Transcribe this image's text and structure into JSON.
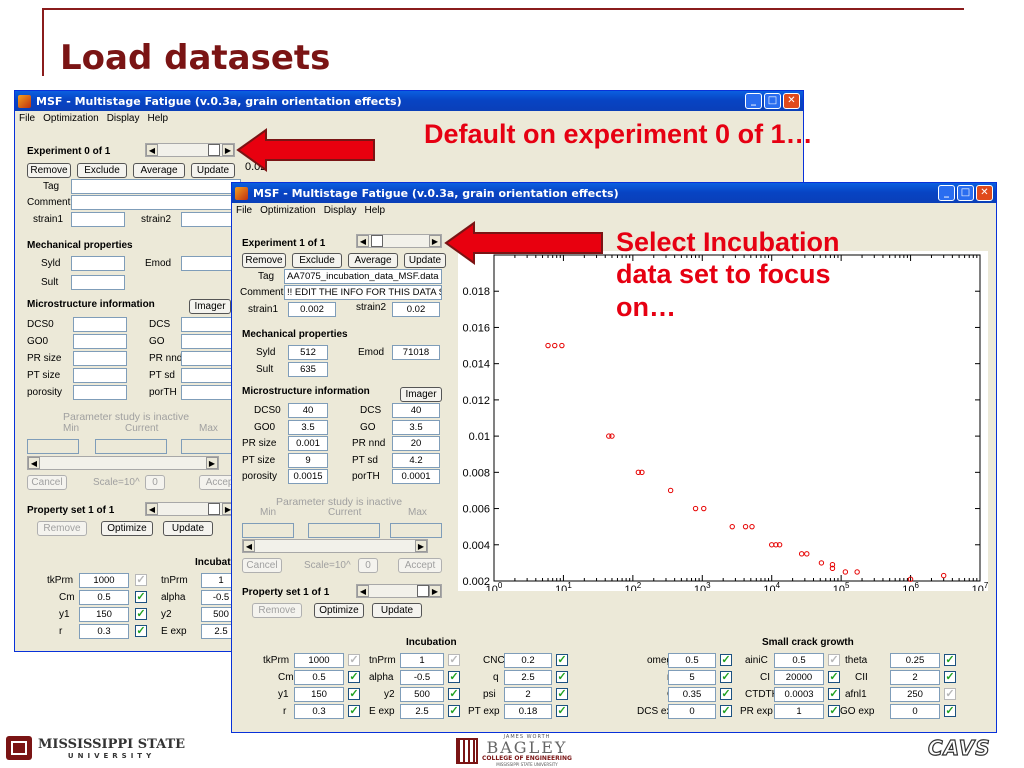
{
  "slide": {
    "title": "Load datasets",
    "callout_default": "Default on experiment 0 of 1…",
    "callout_select": [
      "Select Incubation",
      "data set to focus",
      "on…"
    ]
  },
  "window_back": {
    "title": "MSF - Multistage Fatigue (v.0.3a, grain orientation effects)",
    "menu": [
      "File",
      "Optimization",
      "Display",
      "Help"
    ],
    "experiment_label": "Experiment 0 of 1",
    "buttons": [
      "Remove",
      "Exclude",
      "Average",
      "Update"
    ],
    "tag_label": "Tag",
    "comment_label": "Comment",
    "strain1_label": "strain1",
    "strain2_label": "strain2",
    "mech_header": "Mechanical properties",
    "syld_label": "Syld",
    "emod_label": "Emod",
    "sult_label": "Sult",
    "micro_header": "Microstructure information",
    "imager_label": "Imager",
    "micro_rows": [
      [
        "DCS0",
        "DCS"
      ],
      [
        "GO0",
        "GO"
      ],
      [
        "PR size",
        "PR nnd"
      ],
      [
        "PT size",
        "PT sd"
      ],
      [
        "porosity",
        "porTH"
      ]
    ],
    "param_status": "Parameter study is inactive",
    "param_cols": [
      "Min",
      "Current",
      "Max"
    ],
    "cancel_label": "Cancel",
    "scale_label": "Scale=10^",
    "scale_value": "0",
    "accept_label": "Accept",
    "property_set_label": "Property set 1 of 1",
    "remove_label": "Remove",
    "optimize_label": "Optimize",
    "update_label": "Update",
    "incubation_partial": "Incubati",
    "y_tick_partial": "0.02",
    "params": [
      {
        "name": "tkPrm",
        "value": "1000",
        "name2": "tnPrm",
        "value2": "1"
      },
      {
        "name": "Cm",
        "value": "0.5",
        "name2": "alpha",
        "value2": "-0.5"
      },
      {
        "name": "y1",
        "value": "150",
        "name2": "y2",
        "value2": "500"
      },
      {
        "name": "r",
        "value": "0.3",
        "name2": "E exp",
        "value2": "2.5"
      }
    ]
  },
  "window_front": {
    "title": "MSF - Multistage Fatigue (v.0.3a, grain orientation effects)",
    "menu": [
      "File",
      "Optimization",
      "Display",
      "Help"
    ],
    "experiment_label": "Experiment 1 of 1",
    "buttons": [
      "Remove",
      "Exclude",
      "Average",
      "Update"
    ],
    "tag_label": "Tag",
    "tag_value": "AA7075_incubation_data_MSF.data",
    "comment_label": "Comment",
    "comment_value": "!! EDIT THE INFO FOR THIS DATA SET",
    "strain1_label": "strain1",
    "strain1_value": "0.002",
    "strain2_label": "strain2",
    "strain2_value": "0.02",
    "mech_header": "Mechanical properties",
    "syld_label": "Syld",
    "syld_value": "512",
    "emod_label": "Emod",
    "emod_value": "71018",
    "sult_label": "Sult",
    "sult_value": "635",
    "micro_header": "Microstructure information",
    "imager_label": "Imager",
    "micro_rows": [
      {
        "l1": "DCS0",
        "v1": "40",
        "l2": "DCS",
        "v2": "40"
      },
      {
        "l1": "GO0",
        "v1": "3.5",
        "l2": "GO",
        "v2": "3.5"
      },
      {
        "l1": "PR size",
        "v1": "0.001",
        "l2": "PR nnd",
        "v2": "20"
      },
      {
        "l1": "PT size",
        "v1": "9",
        "l2": "PT sd",
        "v2": "4.2"
      },
      {
        "l1": "porosity",
        "v1": "0.0015",
        "l2": "porTH",
        "v2": "0.0001"
      }
    ],
    "param_status": "Parameter study is inactive",
    "param_cols": [
      "Min",
      "Current",
      "Max"
    ],
    "cancel_label": "Cancel",
    "scale_label": "Scale=10^",
    "scale_value": "0",
    "accept_label": "Accept",
    "property_set_label": "Property set 1 of 1",
    "remove_label": "Remove",
    "optimize_label": "Optimize",
    "update_label": "Update",
    "incubation_header": "Incubation",
    "small_crack_header": "Small crack growth",
    "incubation_rows": [
      {
        "n1": "tkPrm",
        "v1": "1000",
        "c1": false,
        "n2": "tnPrm",
        "v2": "1",
        "c2": false,
        "n3": "CNC",
        "v3": "0.2",
        "c3": true
      },
      {
        "n1": "Cm",
        "v1": "0.5",
        "c1": true,
        "n2": "alpha",
        "v2": "-0.5",
        "c2": true,
        "n3": "q",
        "v3": "2.5",
        "c3": true
      },
      {
        "n1": "y1",
        "v1": "150",
        "c1": true,
        "n2": "y2",
        "v2": "500",
        "c2": true,
        "n3": "psi",
        "v3": "2",
        "c3": true
      },
      {
        "n1": "r",
        "v1": "0.3",
        "c1": true,
        "n2": "E exp",
        "v2": "2.5",
        "c2": true,
        "n3": "PT exp",
        "v3": "0.18",
        "c3": true
      }
    ],
    "crack_rows": [
      {
        "n1": "omega",
        "v1": "0.5",
        "c1": true,
        "n2": "ainiC",
        "v2": "0.5",
        "c2": false,
        "n3": "theta",
        "v3": "0.25",
        "c3": true
      },
      {
        "n1": "m",
        "v1": "5",
        "c1": true,
        "n2": "CI",
        "v2": "20000",
        "c2": true,
        "n3": "CII",
        "v3": "2",
        "c3": true
      },
      {
        "n1": "G",
        "v1": "0.35",
        "c1": true,
        "n2": "CTDTH",
        "v2": "0.0003",
        "c2": true,
        "n3": "afnl1",
        "v3": "250",
        "c3": false
      },
      {
        "n1": "DCS exp",
        "v1": "0",
        "c1": true,
        "n2": "PR exp",
        "v2": "1",
        "c2": true,
        "n3": "GO exp",
        "v3": "0",
        "c3": true
      }
    ]
  },
  "chart_data": {
    "type": "scatter",
    "title": "",
    "xlabel": "",
    "ylabel": "",
    "x_scale": "log",
    "xlim": [
      1,
      10000000
    ],
    "ylim": [
      0.002,
      0.02
    ],
    "x_ticks": [
      "10^0",
      "10^1",
      "10^2",
      "10^3",
      "10^4",
      "10^5",
      "10^6",
      "10^7"
    ],
    "y_ticks": [
      "0.002",
      "0.004",
      "0.006",
      "0.008",
      "0.01",
      "0.012",
      "0.014",
      "0.016",
      "0.018"
    ],
    "marker_color": "#e60000",
    "points": [
      {
        "x": 6,
        "y": 0.015
      },
      {
        "x": 7.5,
        "y": 0.015
      },
      {
        "x": 9.5,
        "y": 0.015
      },
      {
        "x": 45,
        "y": 0.01
      },
      {
        "x": 50,
        "y": 0.01
      },
      {
        "x": 120,
        "y": 0.008
      },
      {
        "x": 135,
        "y": 0.008
      },
      {
        "x": 350,
        "y": 0.007
      },
      {
        "x": 800,
        "y": 0.006
      },
      {
        "x": 1050,
        "y": 0.006
      },
      {
        "x": 2700,
        "y": 0.005
      },
      {
        "x": 4200,
        "y": 0.005
      },
      {
        "x": 5200,
        "y": 0.005
      },
      {
        "x": 10000,
        "y": 0.004
      },
      {
        "x": 11500,
        "y": 0.004
      },
      {
        "x": 13000,
        "y": 0.004
      },
      {
        "x": 27000,
        "y": 0.0035
      },
      {
        "x": 32000,
        "y": 0.0035
      },
      {
        "x": 52000,
        "y": 0.003
      },
      {
        "x": 75000,
        "y": 0.0029
      },
      {
        "x": 75000,
        "y": 0.0027
      },
      {
        "x": 115000,
        "y": 0.0025
      },
      {
        "x": 170000,
        "y": 0.0025
      },
      {
        "x": 1000000,
        "y": 0.0021
      },
      {
        "x": 3000000,
        "y": 0.0023
      }
    ]
  },
  "footer": {
    "msu_name": "MISSISSIPPI STATE",
    "msu_sub": "UNIVERSITY",
    "bagley_top": "JAMES WORTH",
    "bagley_name": "BAGLEY",
    "bagley_sub": "COLLEGE OF ENGINEERING",
    "bagley_sub2": "MISSISSIPPI STATE UNIVERSITY",
    "cavs": "CAVS"
  },
  "colors": {
    "accent": "#7a1414",
    "callout": "#e60012",
    "xp_title": "#0a5fe0"
  }
}
